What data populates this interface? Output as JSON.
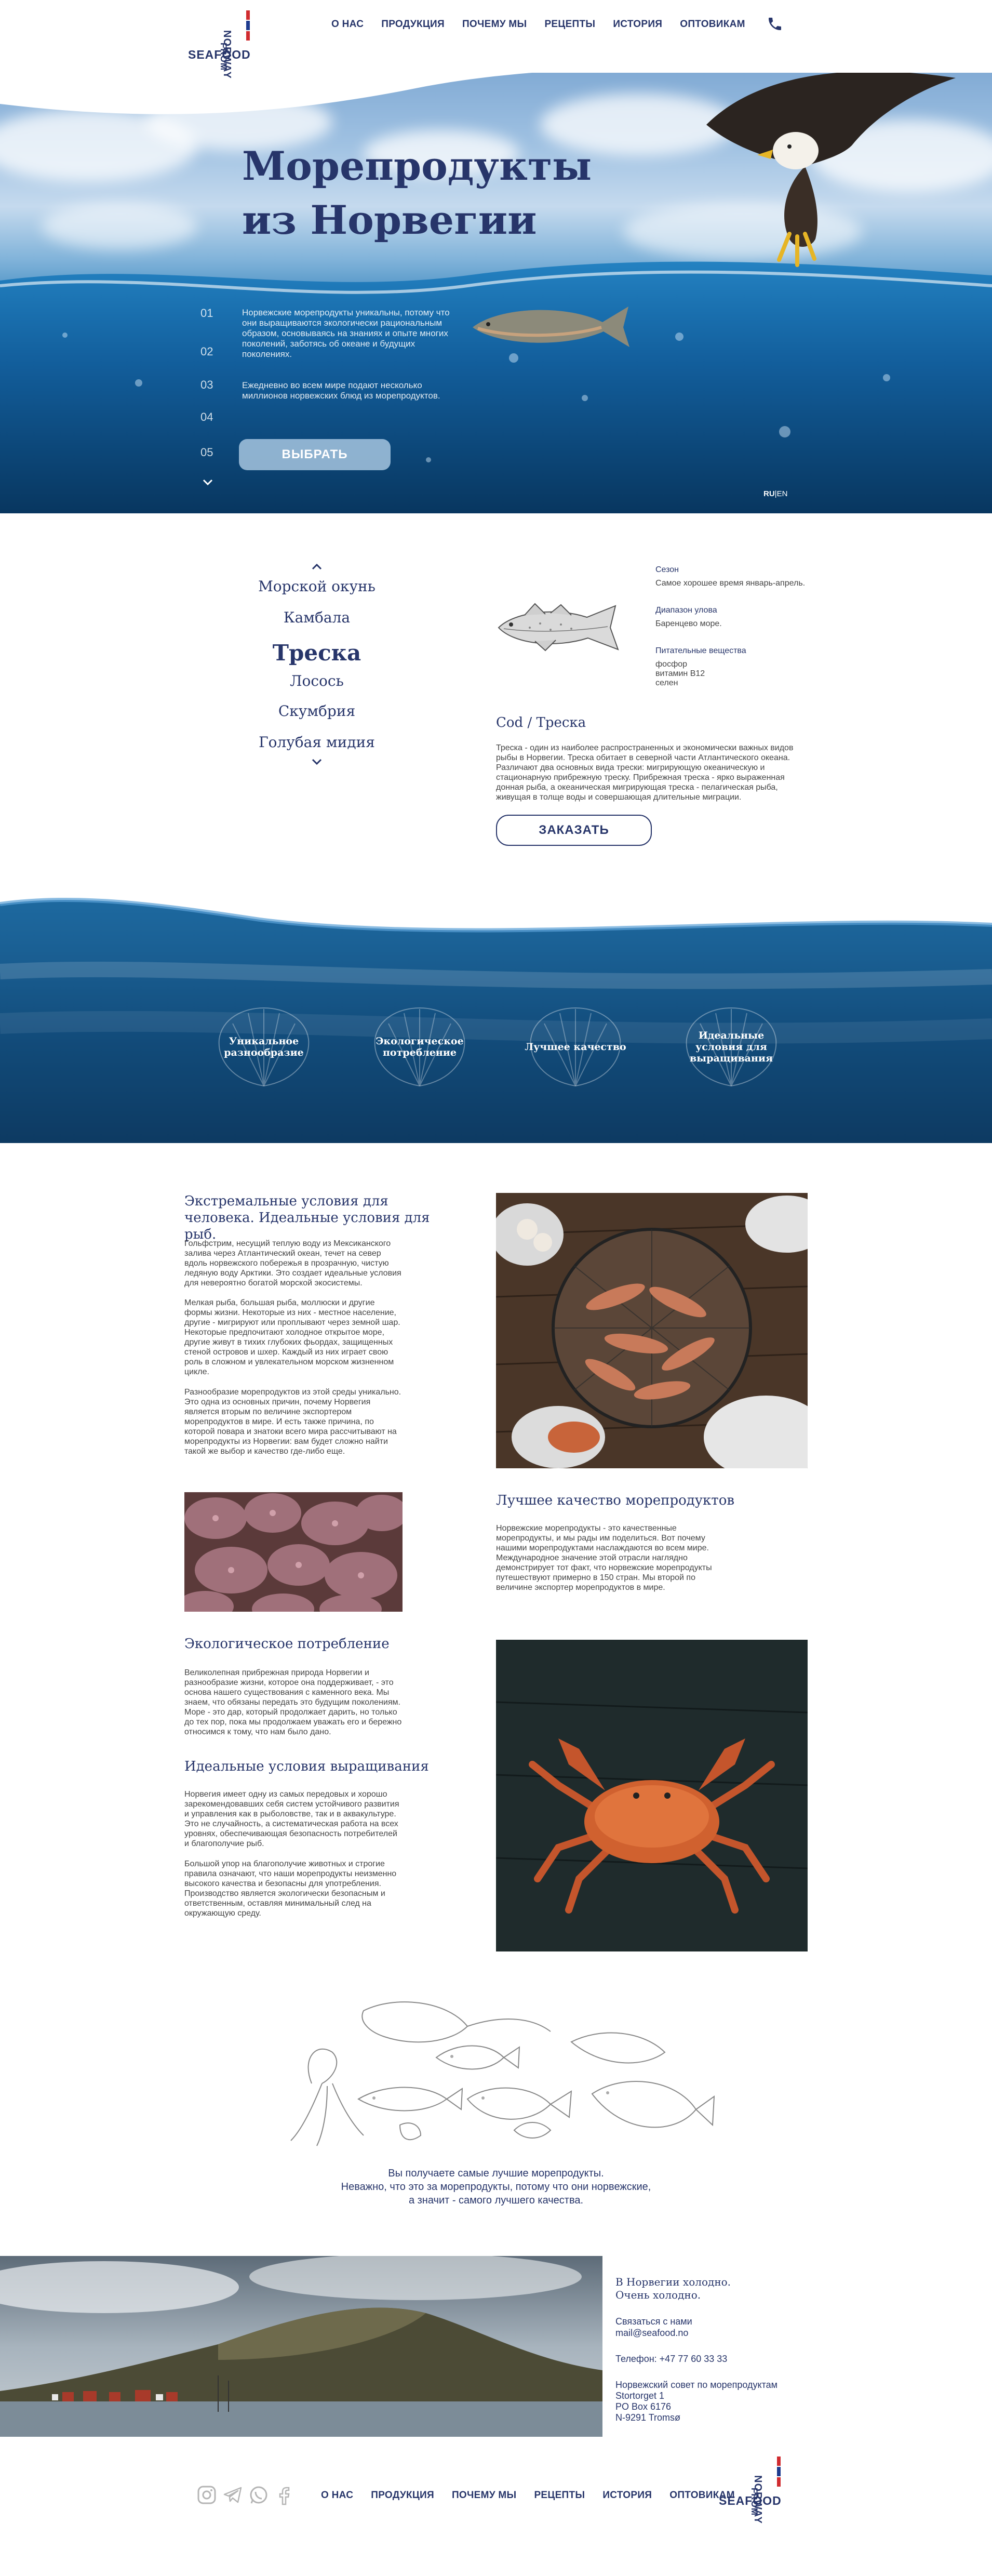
{
  "header": {
    "logo_words": [
      "FROM",
      "NORWAY",
      "SEAFOOD"
    ],
    "nav": [
      "О НАС",
      "ПРОДУКЦИЯ",
      "ПОЧЕМУ МЫ",
      "РЕЦЕПТЫ",
      "ИСТОРИЯ",
      "ОПТОВИКАМ"
    ],
    "phone_icon": "phone-icon"
  },
  "hero": {
    "title_line1": "Морепродукты",
    "title_line2": "из Норвегии",
    "steps": [
      "01",
      "02",
      "03",
      "04",
      "05"
    ],
    "text1": "Норвежские морепродукты уникальны, потому что они выращиваются экологически рациональным образом, основываясь на знаниях и опыте многих поколений, заботясь об океане и будущих поколениях.",
    "text2": "Ежедневно во всем мире подают несколько миллионов норвежских блюд из морепродуктов.",
    "button": "ВЫБРАТЬ",
    "lang_ru": "RU",
    "lang_sep": "|",
    "lang_en": "EN"
  },
  "products": {
    "items": [
      "Морской окунь",
      "Камбала",
      "Треска",
      "Лосось",
      "Скумбрия",
      "Голубая мидия"
    ],
    "selected": "Треска",
    "season_label": "Сезон",
    "season_value": "Самое хорошее время январь-апрель.",
    "range_label": "Диапазон улова",
    "range_value": "Баренцево море.",
    "nutrients_label": "Питательные вещества",
    "nutrients": [
      "фосфор",
      "витамин B12",
      "селен"
    ],
    "cod_title": "Cod / Треска",
    "cod_desc": "Треска - один из наиболее распространенных и экономически важных видов рыбы в Норвегии. Треска обитает в северной части Атлантического океана. Различают два основных вида трески: мигрирующую океаническую и стационарную прибрежную треску. Прибрежная треска - ярко выраженная донная рыба, а океаническая мигрирующая треска - пелагическая рыба, живущая в толще воды и совершающая длительные миграции.",
    "order_button": "ЗАКАЗАТЬ"
  },
  "features": [
    "Уникальное разнообразие",
    "Экологическое потребление",
    "Лучшее качество",
    "Идеальные условия для выращивания"
  ],
  "articles": {
    "a1_title": "Экстремальные условия для человека. Идеальные условия для рыб.",
    "a1_p1": "Гольфстрим, несущий теплую воду из Мексиканского залива через Атлантический океан, течет на север вдоль норвежского побережья в прозрачную, чистую ледяную воду Арктики. Это создает идеальные условия для невероятно богатой морской экосистемы.",
    "a1_p2": "Мелкая рыба, большая рыба, моллюски и другие формы жизни. Некоторые из них - местное население, другие - мигрируют или проплывают через земной шар. Некоторые предпочитают холодное открытое море, другие живут в тихих глубоких фьордах, защищенных стеной островов и шхер. Каждый из них играет свою роль в сложном и увлекательном морском жизненном цикле.",
    "a1_p3": "Разнообразие морепродуктов из этой среды уникально. Это одна из основных причин, почему Норвегия является вторым по величине экспортером морепродуктов в мире. И есть также причина, по которой повара и знатоки всего мира рассчитывают на морепродукты из Норвегии: вам будет сложно найти такой же выбор и качество где-либо еще.",
    "a2_title": "Лучшее качество морепродуктов",
    "a2_p1": "Норвежские морепродукты - это качественные морепродукты, и мы рады им поделиться. Вот почему нашими морепродуктами наслаждаются во всем мире. Международное значение этой отрасли наглядно демонстрирует тот факт, что норвежские морепродукты путешествуют примерно в 150 стран. Мы второй по величине экспортер морепродуктов в мире.",
    "a3_title": "Экологическое потребление",
    "a3_p1": "Великолепная прибрежная природа Норвегии и разнообразие жизни, которое она поддерживает, - это основа нашего существования с каменного века. Мы знаем, что обязаны передать это будущим поколениям. Море - это дар, который продолжает дарить, но только до тех пор, пока мы продолжаем уважать его и бережно относимся к тому, что нам было дано.",
    "a4_title": "Идеальные условия выращивания",
    "a4_p1": "Норвегия имеет одну из самых передовых и хорошо зарекомендовавших себя систем устойчивого развития и управления как в рыболовстве, так и в аквакультуре. Это не случайность, а систематическая работа на всех уровнях, обеспечивающая безопасность потребителей и благополучие рыб.",
    "a4_p2": "Большой упор на благополучие животных и строгие правила означают, что наши морепродукты неизменно высокого качества и безопасны для употребления. Производство является экологически безопасным и ответственным, оставляя минимальный след на окружающую среду."
  },
  "closing": {
    "line1": "Вы получаете самые лучшие морепродукты.",
    "line2": "Неважно, что это за морепродукты, потому что они норвежские,",
    "line3": "а значит - самого лучшего качества."
  },
  "contacts": {
    "tagline1": "В Норвегии холодно.",
    "tagline2": "Очень холодно.",
    "contact_label": "Связаться с нами",
    "email": "mail@seafood.no",
    "phone": "Телефон: +47 77 60 33 33",
    "org": "Норвежский совет по морепродуктам",
    "addr1": "Stortorget 1",
    "addr2": "PO Box 6176",
    "addr3": "N-9291 Tromsø"
  },
  "footer": {
    "social_icons": [
      "instagram-icon",
      "telegram-icon",
      "whatsapp-icon",
      "facebook-icon"
    ],
    "nav": [
      "О НАС",
      "ПРОДУКЦИЯ",
      "ПОЧЕМУ МЫ",
      "РЕЦЕПТЫ",
      "ИСТОРИЯ",
      "ОПТОВИКАМ"
    ],
    "logo_words": [
      "FROM",
      "NORWAY",
      "SEAFOOD"
    ]
  },
  "colors": {
    "brand_navy": "#27356a",
    "flag_red": "#d02b2f",
    "flag_blue": "#1d3b8e"
  }
}
